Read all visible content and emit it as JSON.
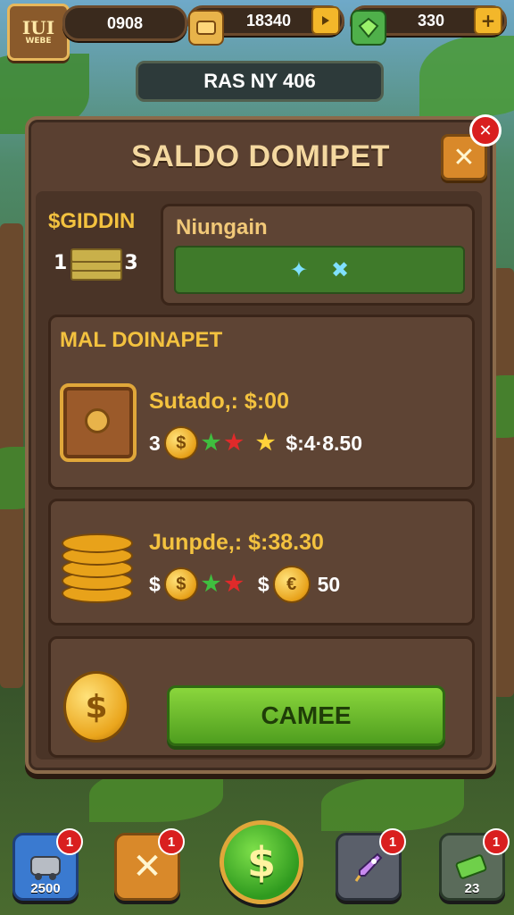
{
  "top_bar": {
    "logo_line1": "IUI",
    "logo_line2": "WEBE",
    "stat1_value": "0908",
    "stat2_value": "18340",
    "stat3_value": "330",
    "plus_label": "+"
  },
  "banner": {
    "text": "RAS NY 406"
  },
  "panel": {
    "title": "SALDO DOMIPET",
    "close_x": "✕",
    "close_dot": "✕"
  },
  "balance": {
    "label": "$GIDDIN",
    "left_num": "1",
    "right_num": "3"
  },
  "nudge": {
    "label": "Niungain",
    "mark1": "✦",
    "mark2": "✖"
  },
  "section1": {
    "title": "MAL DOINAPET"
  },
  "row1": {
    "title": "Sutado,: $:00",
    "prefix": "3",
    "value": "$:4·8.50"
  },
  "row2": {
    "title": "Junpde,: $:38.30",
    "prefix": "$",
    "value_prefix": "$",
    "value": "50"
  },
  "cta": {
    "label": "CAMEE",
    "coin_symbol": "$"
  },
  "bottom_bar": {
    "item1_label": "2500",
    "item1_badge": "1",
    "item2_badge": "1",
    "item4_badge": "1",
    "item5_label": "23",
    "item5_badge": "1"
  },
  "colors": {
    "panel": "#5a4031",
    "accent_gold": "#f3c23f",
    "button_green": "#5fb52a",
    "alert_red": "#d91f1f"
  }
}
